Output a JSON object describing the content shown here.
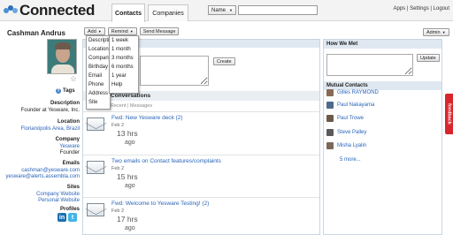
{
  "app": {
    "title": "Connected",
    "top_links": "Apps | Settings | Logout"
  },
  "tabs": [
    {
      "label": "Contacts"
    },
    {
      "label": "Companies"
    }
  ],
  "search": {
    "field_select": "Name",
    "placeholder": ""
  },
  "profile": {
    "name": "Cashman Andrus",
    "tags_label": "Tags",
    "description_label": "Description",
    "description": "Founder at Yesware, Inc.",
    "location_label": "Location",
    "location": "Florianópolis Area, Brazil",
    "company_label": "Company",
    "company": "Yesware",
    "title": "Founder",
    "emails_label": "Emails",
    "emails": [
      "cashman@yesware.com",
      "yesware@alerts.assembla.com"
    ],
    "sites_label": "Sites",
    "sites": [
      "Company Website",
      "Personal Website"
    ],
    "profiles_label": "Profiles",
    "profiles": [
      {
        "name": "linkedin-icon",
        "glyph": "in",
        "color": "#1b6fb0"
      },
      {
        "name": "twitter-icon",
        "glyph": "t",
        "color": "#43b4e8"
      }
    ]
  },
  "toolbar": {
    "add": "Add",
    "remind": "Remind",
    "send_message": "Send Message",
    "admin": "Admin",
    "create": "Create"
  },
  "add_menu": [
    "Description",
    "Location",
    "Company",
    "Birthday",
    "Email",
    "Phone",
    "Address",
    "Site"
  ],
  "remind_menu": [
    "1 week",
    "1 month",
    "3 months",
    "6 months",
    "1 year",
    "Help"
  ],
  "conversations": {
    "title": "Conversations",
    "subtitle": "Recent | Messages",
    "items": [
      {
        "subject": "Fwd: New Yesware deck (2)",
        "date": "Feb 2",
        "age": "13 hrs",
        "ago": "ago"
      },
      {
        "subject": "Two emails on Contact features/complaints",
        "date": "Feb 2",
        "age": "15 hrs",
        "ago": "ago"
      },
      {
        "subject": "Fwd: Welcome to Yesware Testing! (2)",
        "date": "Feb 2",
        "age": "17 hrs",
        "ago": "ago"
      }
    ]
  },
  "how_we_met": {
    "title": "How We Met",
    "update": "Update"
  },
  "mutual": {
    "title": "Mutual Contacts",
    "contacts": [
      {
        "name": "Gilles RAYMOND",
        "color": "#8a6a55"
      },
      {
        "name": "Paul Nakayama",
        "color": "#4f6a8a"
      },
      {
        "name": "Paul Trowe",
        "color": "#6b5a4a"
      },
      {
        "name": "Steve Palley",
        "color": "#5a5a5a"
      },
      {
        "name": "Misha Lyalin",
        "color": "#7a6a5a"
      }
    ],
    "more": "5 more..."
  },
  "feedback": "feedback"
}
